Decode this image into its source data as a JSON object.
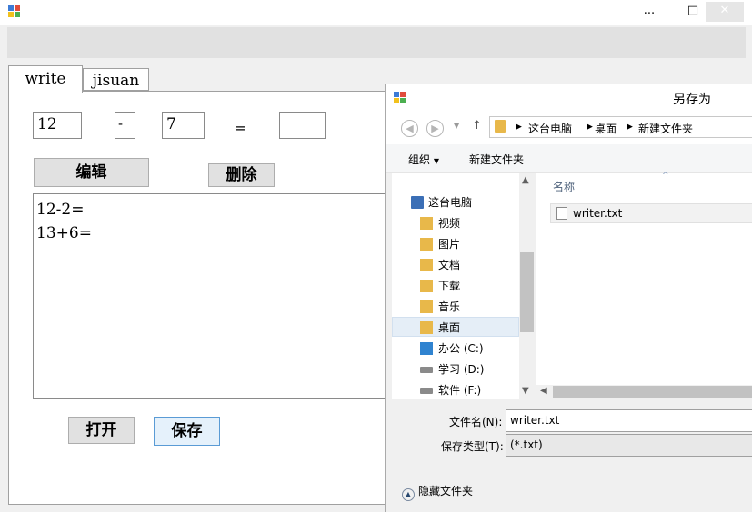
{
  "main_window": {
    "min_label": "...",
    "max_label": "□",
    "close_label": "✕"
  },
  "tabs": [
    {
      "label": "write",
      "active": true
    },
    {
      "label": "jisuan",
      "active": false
    }
  ],
  "calc": {
    "operand1": "12",
    "operator": "-",
    "operand2": "7",
    "equals": "=",
    "result": ""
  },
  "buttons": {
    "edit": "编辑",
    "delete": "删除",
    "open": "打开",
    "save": "保存"
  },
  "editor": {
    "lines": [
      "12-2=",
      "13+6="
    ]
  },
  "save_dialog": {
    "title": "另存为",
    "breadcrumb": [
      "这台电脑",
      "桌面",
      "新建文件夹"
    ],
    "toolbar": {
      "organize": "组织",
      "new_folder": "新建文件夹"
    },
    "tree": [
      {
        "label": "这台电脑",
        "icon": "computer-icon"
      },
      {
        "label": "视频",
        "icon": "folder-icon"
      },
      {
        "label": "图片",
        "icon": "folder-icon"
      },
      {
        "label": "文档",
        "icon": "folder-icon"
      },
      {
        "label": "下载",
        "icon": "folder-icon"
      },
      {
        "label": "音乐",
        "icon": "folder-icon"
      },
      {
        "label": "桌面",
        "icon": "folder-icon",
        "selected": true
      },
      {
        "label": "办公 (C:)",
        "icon": "drive-icon"
      },
      {
        "label": "学习 (D:)",
        "icon": "drive-icon"
      },
      {
        "label": "软件 (F:)",
        "icon": "drive-icon"
      }
    ],
    "column_name": "名称",
    "files": [
      {
        "name": "writer.txt",
        "icon": "text-file-icon"
      }
    ],
    "filename_label": "文件名(N):",
    "filename_value": "writer.txt",
    "filetype_label": "保存类型(T):",
    "filetype_value": "(*.txt)",
    "hide_folders": "隐藏文件夹"
  },
  "colors": {
    "accent": "#5a9bd5",
    "folder": "#e8b84a",
    "selection": "#e5eef7"
  }
}
